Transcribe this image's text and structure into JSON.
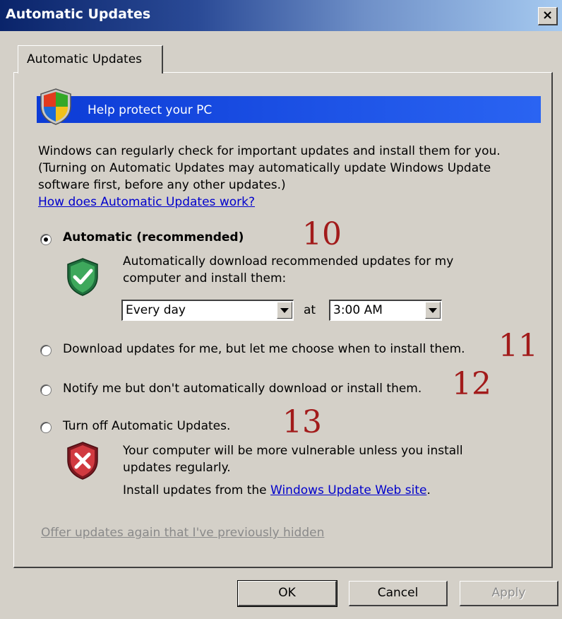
{
  "window": {
    "title": "Automatic Updates",
    "close_label": "×"
  },
  "tab": {
    "label": "Automatic Updates"
  },
  "banner": {
    "text": "Help protect your PC",
    "icon": "windows-shield-icon"
  },
  "description": {
    "line1": "Windows can regularly check for important updates and install them for you.",
    "line2": "(Turning on Automatic Updates may automatically update Windows Update",
    "line3": "software first, before any other updates.)",
    "link": "How does Automatic Updates work?"
  },
  "options": {
    "automatic": {
      "label": "Automatic (recommended)",
      "selected": true,
      "marker": "10",
      "desc_line1": "Automatically download recommended updates for my",
      "desc_line2": "computer and install them:",
      "icon": "green-check-shield-icon",
      "day_value": "Every day",
      "at_label": "at",
      "time_value": "3:00 AM"
    },
    "download": {
      "label": "Download updates for me, but let me choose when to install them.",
      "selected": false,
      "marker": "11"
    },
    "notify": {
      "label": "Notify me but don't automatically download or install them.",
      "selected": false,
      "marker": "12"
    },
    "off": {
      "label": "Turn off Automatic Updates.",
      "selected": false,
      "marker": "13",
      "icon": "red-x-shield-icon",
      "warn_line1": "Your computer will be more vulnerable unless you install",
      "warn_line2": "updates regularly.",
      "install_prefix": "Install updates from the ",
      "install_link": "Windows Update Web site",
      "install_suffix": "."
    }
  },
  "hidden_updates_link": "Offer updates again that I've previously hidden",
  "buttons": {
    "ok": "OK",
    "cancel": "Cancel",
    "apply": "Apply"
  },
  "colors": {
    "title_start": "#0a246a",
    "title_end": "#a6caf0",
    "banner": "#0c3bd6",
    "dialog": "#d4d0c8",
    "marker": "#a21b1b",
    "link": "#0000cc"
  }
}
